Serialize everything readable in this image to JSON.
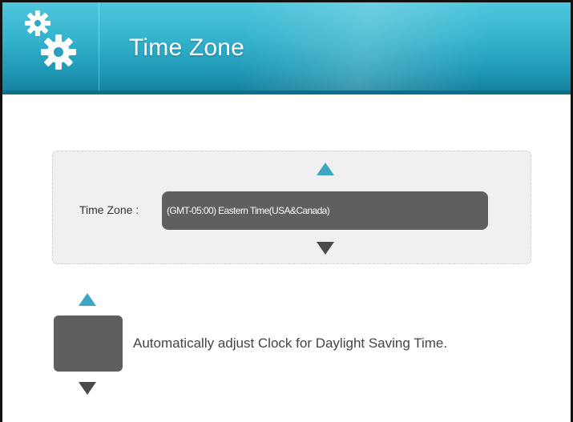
{
  "header": {
    "title": "Time Zone",
    "icon": "gears-icon"
  },
  "time_zone": {
    "label": "Time Zone :",
    "selected_value": "(GMT-05:00) Eastern Time(USA&Canada)"
  },
  "daylight_saving": {
    "label": "Automatically adjust Clock for Daylight Saving Time."
  },
  "colors": {
    "header_blue": "#34b3cc",
    "arrow_up": "#3ba7c2",
    "control_gray": "#5f5f5f"
  }
}
